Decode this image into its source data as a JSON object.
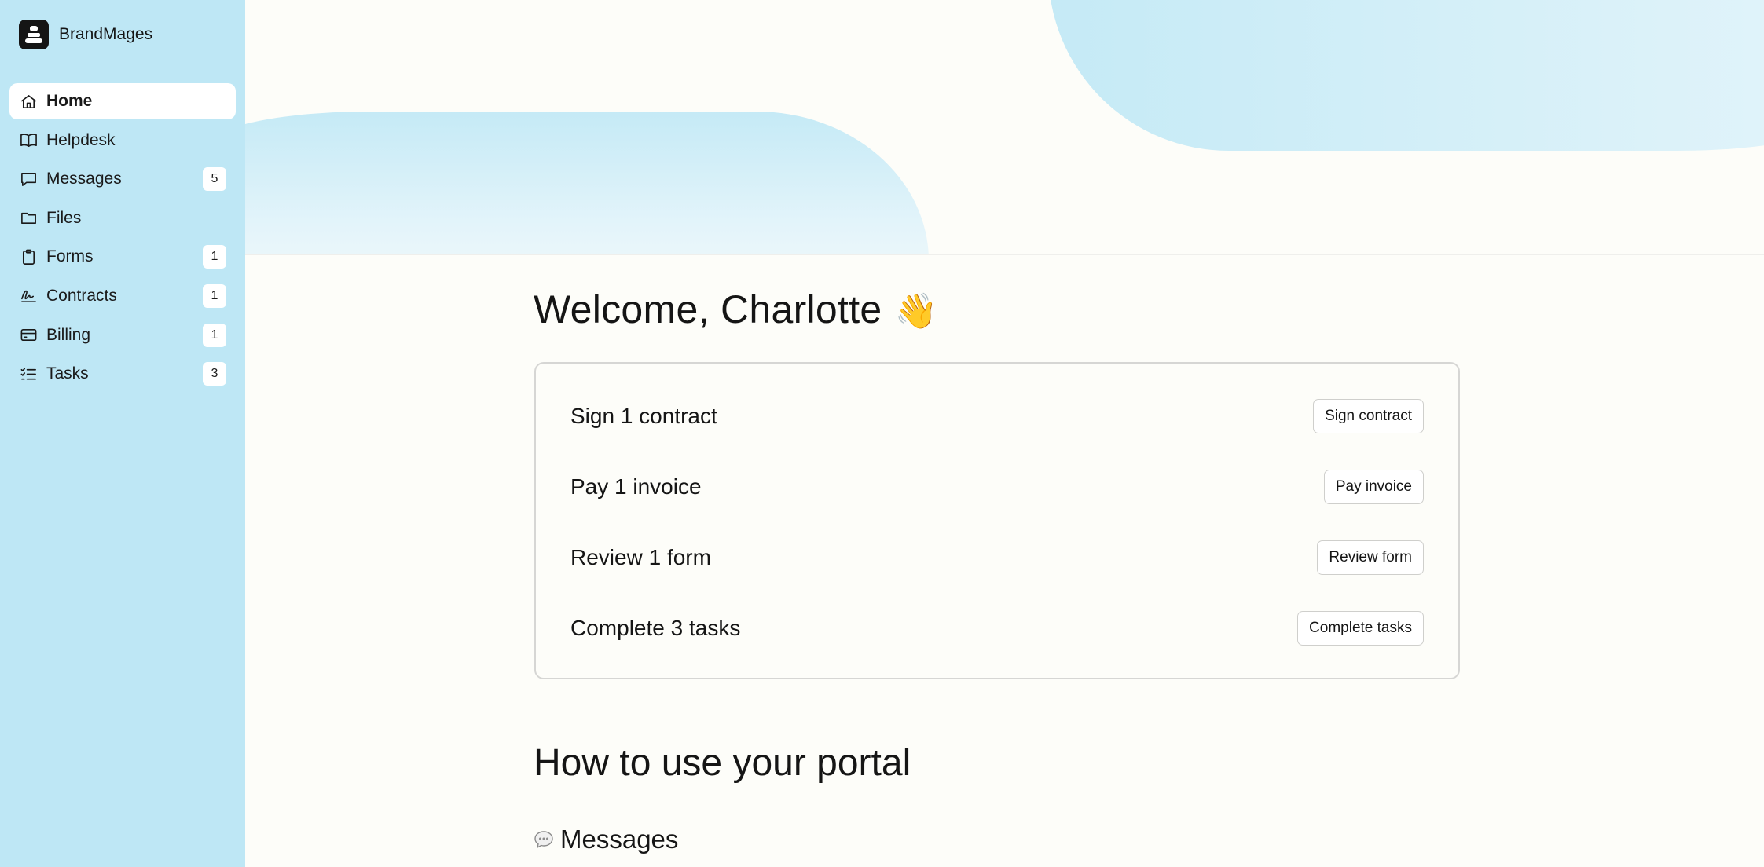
{
  "brand": {
    "name": "BrandMages"
  },
  "sidebar": {
    "items": [
      {
        "label": "Home",
        "icon": "home-icon",
        "badge": "",
        "active": true
      },
      {
        "label": "Helpdesk",
        "icon": "book-icon",
        "badge": ""
      },
      {
        "label": "Messages",
        "icon": "chat-icon",
        "badge": "5"
      },
      {
        "label": "Files",
        "icon": "folder-icon",
        "badge": ""
      },
      {
        "label": "Forms",
        "icon": "clipboard-icon",
        "badge": "1"
      },
      {
        "label": "Contracts",
        "icon": "signature-icon",
        "badge": "1"
      },
      {
        "label": "Billing",
        "icon": "credit-card-icon",
        "badge": "1"
      },
      {
        "label": "Tasks",
        "icon": "checklist-icon",
        "badge": "3"
      }
    ]
  },
  "main": {
    "welcome": "Welcome, Charlotte",
    "wave_emoji": "👋",
    "tasks": [
      {
        "label": "Sign 1 contract",
        "button": "Sign contract"
      },
      {
        "label": "Pay 1 invoice",
        "button": "Pay invoice"
      },
      {
        "label": "Review 1 form",
        "button": "Review form"
      },
      {
        "label": "Complete 3 tasks",
        "button": "Complete tasks"
      }
    ],
    "section_title": "How to use your portal",
    "sub_section": {
      "icon": "speech-bubble-icon",
      "title": "Messages"
    }
  },
  "colors": {
    "sidebar_bg": "#bee7f5",
    "page_bg": "#fdfdf9",
    "text": "#151515"
  }
}
